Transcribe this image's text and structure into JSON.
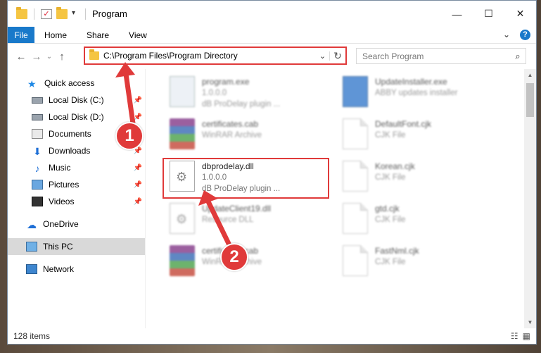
{
  "window": {
    "title": "Program",
    "controls": {
      "minimize": "—",
      "maximize": "☐",
      "close": "✕"
    }
  },
  "ribbon": {
    "tabs": [
      "File",
      "Home",
      "Share",
      "View"
    ],
    "expand": "⌄",
    "help": "?"
  },
  "address": {
    "path": "C:\\Program Files\\Program Directory",
    "dropdown": "⌄",
    "refresh": "↻",
    "nav_back": "←",
    "nav_forward": "→",
    "nav_recent": "⌄",
    "nav_up": "↑"
  },
  "search": {
    "placeholder": "Search Program",
    "icon": "search-icon"
  },
  "sidebar": {
    "items": [
      {
        "label": "Quick access",
        "icon": "star-icon"
      },
      {
        "label": "Local Disk (C:)",
        "icon": "drive-icon",
        "pinned": true
      },
      {
        "label": "Local Disk (D:)",
        "icon": "drive-icon",
        "pinned": true
      },
      {
        "label": "Documents",
        "icon": "documents-icon",
        "pinned": true
      },
      {
        "label": "Downloads",
        "icon": "downloads-icon",
        "pinned": true
      },
      {
        "label": "Music",
        "icon": "music-icon",
        "pinned": true
      },
      {
        "label": "Pictures",
        "icon": "pictures-icon",
        "pinned": true
      },
      {
        "label": "Videos",
        "icon": "videos-icon",
        "pinned": true
      },
      {
        "label": "OneDrive",
        "icon": "onedrive-icon"
      },
      {
        "label": "This PC",
        "icon": "pc-icon",
        "selected": true
      },
      {
        "label": "Network",
        "icon": "network-icon"
      }
    ]
  },
  "files": [
    {
      "name": "program.exe",
      "line2": "1.0.0.0",
      "line3": "dB ProDelay plugin ...",
      "icon": "exe-icon"
    },
    {
      "name": "UpdateInstaller.exe",
      "line2": "ABBY updates installer",
      "line3": "",
      "icon": "update-icon"
    },
    {
      "name": "certificates.cab",
      "line2": "WinRAR Archive",
      "line3": "",
      "icon": "rar-icon"
    },
    {
      "name": "DefaultFont.cjk",
      "line2": "CJK File",
      "line3": "",
      "icon": "document-icon"
    },
    {
      "name": "dbprodelay.dll",
      "line2": "1.0.0.0",
      "line3": "dB ProDelay plugin ...",
      "icon": "dll-icon"
    },
    {
      "name": "Korean.cjk",
      "line2": "CJK File",
      "line3": "",
      "icon": "document-icon"
    },
    {
      "name": "UpdateClient19.dll",
      "line2": "Resource DLL",
      "line3": "",
      "icon": "dll-icon"
    },
    {
      "name": "gtd.cjk",
      "line2": "CJK File",
      "line3": "",
      "icon": "document-icon"
    },
    {
      "name": "certificates.cab",
      "line2": "WinRAR Archive",
      "line3": "",
      "icon": "rar-icon"
    },
    {
      "name": "FastNml.cjk",
      "line2": "CJK File",
      "line3": "",
      "icon": "document-icon"
    }
  ],
  "status": {
    "count": "128 items"
  },
  "annotations": {
    "step1": "1",
    "step2": "2"
  },
  "colors": {
    "accent": "#1979ca",
    "highlight": "#e03a3a",
    "selected_nav": "#d9d9d9"
  }
}
